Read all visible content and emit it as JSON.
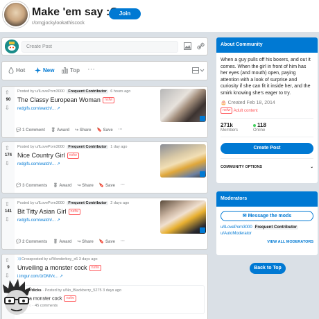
{
  "header": {
    "title": "Make 'em say :O",
    "subreddit": "r/omgjockylookathiscock",
    "join_label": "Join"
  },
  "create_post": {
    "placeholder": "Create Post",
    "image_icon": "image-icon",
    "link_icon": "link-icon"
  },
  "sort": {
    "options": [
      {
        "label": "Hot",
        "icon": "flame-icon"
      },
      {
        "label": "New",
        "icon": "sparkle-icon"
      },
      {
        "label": "Top",
        "icon": "bar-chart-icon"
      }
    ],
    "active": "New"
  },
  "posts": [
    {
      "score": "90",
      "posted_by": "Posted by u/ILovePorn3000",
      "flair": "Frequent Contributor",
      "time": "6 hours ago",
      "title": "The Classy European Woman",
      "nsfw": "nsfw",
      "link": "redgifs.com/watch/...",
      "comments": "1 Comment",
      "award": "Award",
      "share": "Share",
      "save": "Save"
    },
    {
      "score": "174",
      "posted_by": "Posted by u/ILovePorn3000",
      "flair": "Frequent Contributor",
      "time": "1 day ago",
      "title": "Nice Country Girl",
      "nsfw": "nsfw",
      "link": "redgifs.com/watch/...",
      "comments": "3 Comments",
      "award": "Award",
      "share": "Share",
      "save": "Save"
    },
    {
      "score": "141",
      "posted_by": "Posted by u/ILovePorn3000",
      "flair": "Frequent Contributor",
      "time": "2 days ago",
      "title": "Bit Titty Asian Girl",
      "nsfw": "nsfw",
      "link": "redgifs.com/watch/...",
      "comments": "2 Comments",
      "award": "Award",
      "share": "Share",
      "save": "Save"
    },
    {
      "score": "9",
      "posted_by": "Crossposted by u/Wonderboy_x6",
      "time": "3 days ago",
      "title": "Unveiling a monster cock",
      "nsfw": "nsfw",
      "link": "i.imgur.com/1rDMVx...",
      "cross_sub": "r/dicks",
      "cross_posted_by": "Posted by u/No_Blackberry_5275",
      "cross_time": "3 days ago",
      "cross_title": "a monster cock",
      "cross_comments": "45 comments",
      "cross_nsfw": "nsfw"
    }
  ],
  "about": {
    "heading": "About Community",
    "description": "When a guy pulls off his boxers, and out it comes. When the girl in front of him has her eyes (and mouth) open, paying attention with a look of surprise and curiosity if she can fit it inside her, and the smirk knowing she's eager to try.",
    "created": "Created Feb 18, 2014",
    "adult": "Adult content",
    "adult_badge": "nsfw",
    "members_value": "271k",
    "members_label": "Members",
    "online_value": "118",
    "online_label": "Online",
    "create_post": "Create Post",
    "community_options": "COMMUNITY OPTIONS"
  },
  "moderators": {
    "heading": "Moderators",
    "message_label": "Message the mods",
    "mods": [
      {
        "name": "u/ILovePorn3000",
        "flair": "Frequent Contributor"
      },
      {
        "name": "u/AutoModerator",
        "flair": ""
      }
    ],
    "view_all": "VIEW ALL MODERATORS"
  },
  "back_to_top": "Back to Top",
  "colors": {
    "accent": "#0079d3",
    "nsfw": "#ff585b",
    "online": "#46d160",
    "bg": "#dae0e6"
  }
}
